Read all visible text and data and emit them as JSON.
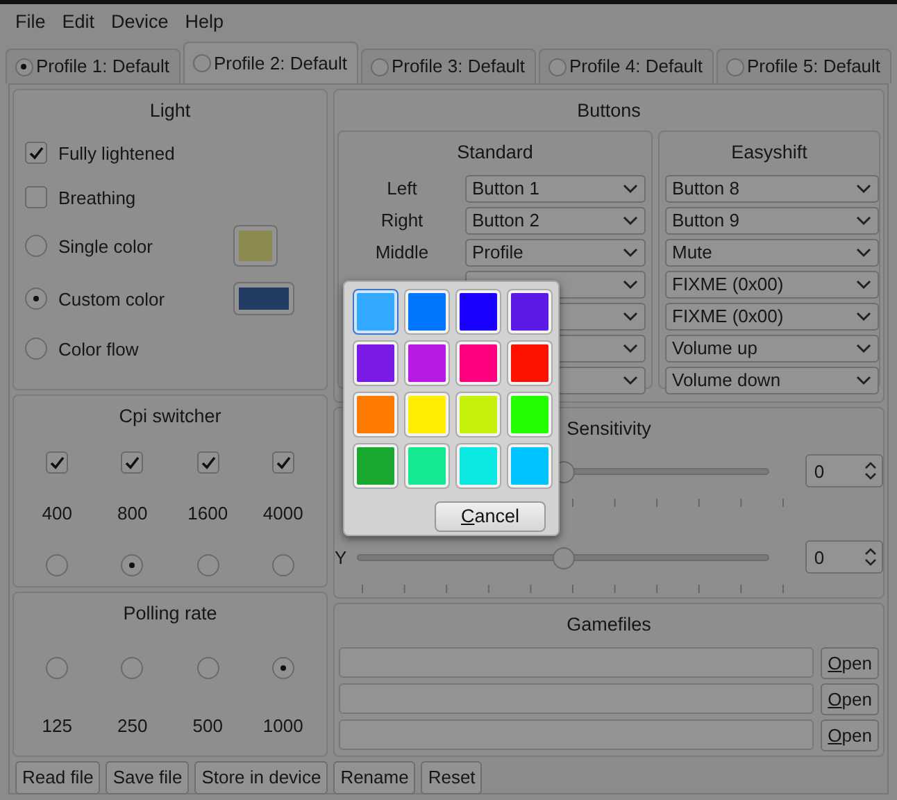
{
  "menu": [
    "File",
    "Edit",
    "Device",
    "Help"
  ],
  "tabs": [
    {
      "label": "Profile 1: Default",
      "selected": false,
      "checked": true
    },
    {
      "label": "Profile 2: Default",
      "selected": true,
      "checked": false
    },
    {
      "label": "Profile 3: Default",
      "selected": false,
      "checked": false
    },
    {
      "label": "Profile 4: Default",
      "selected": false,
      "checked": false
    },
    {
      "label": "Profile 5: Default",
      "selected": false,
      "checked": false
    }
  ],
  "light": {
    "title": "Light",
    "options": [
      {
        "kind": "checkbox",
        "label": "Fully lightened",
        "checked": true
      },
      {
        "kind": "checkbox",
        "label": "Breathing",
        "checked": false
      },
      {
        "kind": "radio",
        "label": "Single color",
        "checked": false,
        "color": "#8c8a50"
      },
      {
        "kind": "radio",
        "label": "Custom color",
        "checked": true,
        "color": "#223c64"
      },
      {
        "kind": "radio",
        "label": "Color flow",
        "checked": false
      }
    ]
  },
  "cpi": {
    "title": "Cpi switcher",
    "levels": [
      {
        "label": "400",
        "checked": true,
        "selected": false
      },
      {
        "label": "800",
        "checked": true,
        "selected": true
      },
      {
        "label": "1600",
        "checked": true,
        "selected": false
      },
      {
        "label": "4000",
        "checked": true,
        "selected": false
      }
    ]
  },
  "polling": {
    "title": "Polling rate",
    "rates": [
      {
        "label": "125",
        "selected": false
      },
      {
        "label": "250",
        "selected": false
      },
      {
        "label": "500",
        "selected": false
      },
      {
        "label": "1000",
        "selected": true
      }
    ]
  },
  "buttons": {
    "title": "Buttons",
    "standard": {
      "title": "Standard",
      "rows": [
        {
          "label": "Left",
          "value": "Button 1"
        },
        {
          "label": "Right",
          "value": "Button 2"
        },
        {
          "label": "Middle",
          "value": "Profile"
        },
        {
          "kind": "covered"
        },
        {
          "kind": "covered"
        },
        {
          "kind": "covered"
        },
        {
          "kind": "covered"
        }
      ]
    },
    "easyshift": {
      "title": "Easyshift",
      "values": [
        "Button 8",
        "Button 9",
        "Mute",
        "FIXME (0x00)",
        "FIXME (0x00)",
        "Volume up",
        "Volume down"
      ]
    }
  },
  "sensitivity": {
    "title": "Sensitivity",
    "axes": [
      {
        "level": 0.5,
        "value": "0"
      },
      {
        "label": "Y",
        "level": 0.5,
        "value": "0"
      }
    ]
  },
  "gamefiles": {
    "title": "Gamefiles",
    "rows": [
      {
        "button": "Open"
      },
      {
        "button": "Open"
      },
      {
        "button": "Open"
      }
    ]
  },
  "actions": [
    "Read file",
    "Save file",
    "Store in device",
    "Rename",
    "Reset"
  ],
  "color_popup": {
    "swatches": [
      {
        "color": "#33a8ff",
        "selected": true
      },
      {
        "color": "#0077ff",
        "selected": false
      },
      {
        "color": "#1a00ff",
        "selected": false
      },
      {
        "color": "#5c1ae6",
        "selected": false
      },
      {
        "color": "#7a1ae6",
        "selected": false
      },
      {
        "color": "#b81ae6",
        "selected": false
      },
      {
        "color": "#ff0080",
        "selected": false
      },
      {
        "color": "#ff1100",
        "selected": false
      },
      {
        "color": "#ff7a00",
        "selected": false
      },
      {
        "color": "#ffee00",
        "selected": false
      },
      {
        "color": "#c4f00a",
        "selected": false
      },
      {
        "color": "#22ff00",
        "selected": false
      },
      {
        "color": "#1aa830",
        "selected": false
      },
      {
        "color": "#14e890",
        "selected": false
      },
      {
        "color": "#0ae8e0",
        "selected": false
      },
      {
        "color": "#00c4ff",
        "selected": false
      }
    ],
    "cancel": "Cancel"
  }
}
